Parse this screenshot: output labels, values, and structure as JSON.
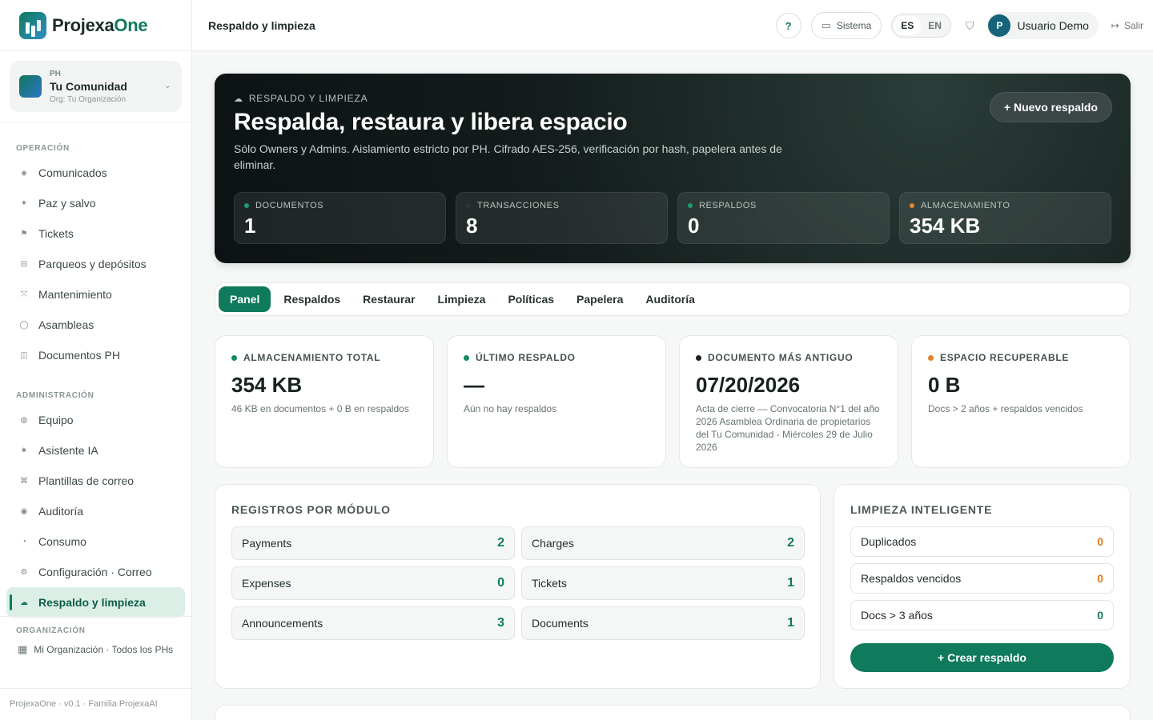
{
  "brand": {
    "name_a": "Projexa",
    "name_b": "One"
  },
  "community": {
    "tag": "PH",
    "name": "Tu Comunidad",
    "org": "Org: Tu Organización"
  },
  "sidebar": {
    "sections": [
      {
        "title": "OPERACIÓN",
        "items": [
          {
            "label": "Comunicados",
            "icon": "◈"
          },
          {
            "label": "Paz y salvo",
            "icon": "✦"
          },
          {
            "label": "Tickets",
            "icon": "⚑"
          },
          {
            "label": "Parqueos y depósitos",
            "icon": "⊟"
          },
          {
            "label": "Mantenimiento",
            "icon": "⤧"
          },
          {
            "label": "Asambleas",
            "icon": "◯"
          },
          {
            "label": "Documentos PH",
            "icon": "◫"
          }
        ]
      },
      {
        "title": "ADMINISTRACIÓN",
        "items": [
          {
            "label": "Equipo",
            "icon": "◍"
          },
          {
            "label": "Asistente IA",
            "icon": "✷"
          },
          {
            "label": "Plantillas de correo",
            "icon": "⌘"
          },
          {
            "label": "Auditoría",
            "icon": "◉"
          },
          {
            "label": "Consumo",
            "icon": "◔"
          },
          {
            "label": "Configuración · Correo",
            "icon": "⚙"
          },
          {
            "label": "Respaldo y limpieza",
            "icon": "☁",
            "active": true
          }
        ]
      }
    ],
    "org_section": "ORGANIZACIÓN",
    "org_item": "Mi Organización · Todos los PHs",
    "footer": "ProjexaOne · v0.1 · Familia ProjexaAI"
  },
  "topbar": {
    "title": "Respaldo y limpieza",
    "help": "?",
    "system": "Sistema",
    "lang_es": "ES",
    "lang_en": "EN",
    "avatar": "P",
    "user": "Usuario Demo",
    "logout": "Salir"
  },
  "hero": {
    "kicker": "RESPALDO Y LIMPIEZA",
    "title": "Respalda, restaura y libera espacio",
    "desc": "Sólo Owners y Admins. Aislamiento estricto por PH. Cifrado AES-256, verificación por hash, papelera antes de eliminar.",
    "button": "+ Nuevo respaldo",
    "stats": [
      {
        "label": "DOCUMENTOS",
        "value": "1",
        "color": "#1f9c6e"
      },
      {
        "label": "TRANSACCIONES",
        "value": "8",
        "color": "#2c3533"
      },
      {
        "label": "RESPALDOS",
        "value": "0",
        "color": "#1f9c6e"
      },
      {
        "label": "ALMACENAMIENTO",
        "value": "354 KB",
        "color": "#e6882a"
      }
    ]
  },
  "tabs": [
    "Panel",
    "Respaldos",
    "Restaurar",
    "Limpieza",
    "Políticas",
    "Papelera",
    "Auditoría"
  ],
  "metrics": [
    {
      "label": "ALMACENAMIENTO TOTAL",
      "value": "354 KB",
      "sub": "46 KB en documentos + 0 B en respaldos",
      "color": "#148a63"
    },
    {
      "label": "ÚLTIMO RESPALDO",
      "value": "—",
      "sub": "Aún no hay respaldos",
      "color": "#148a63"
    },
    {
      "label": "DOCUMENTO MÁS ANTIGUO",
      "value": "07/20/2026",
      "sub": "Acta de cierre — Convocatoria N°1 del año 2026 Asamblea Ordinaria de propietarios del Tu Comunidad - Miércoles 29 de Julio 2026",
      "color": "#16201d"
    },
    {
      "label": "ESPACIO RECUPERABLE",
      "value": "0 B",
      "sub": "Docs > 2 años + respaldos vencidos",
      "color": "#e0822a"
    }
  ],
  "modules": {
    "title": "REGISTROS POR MÓDULO",
    "items": [
      {
        "name": "Payments",
        "count": "2"
      },
      {
        "name": "Charges",
        "count": "2"
      },
      {
        "name": "Expenses",
        "count": "0"
      },
      {
        "name": "Tickets",
        "count": "1"
      },
      {
        "name": "Announcements",
        "count": "3"
      },
      {
        "name": "Documents",
        "count": "1"
      }
    ]
  },
  "cleanup": {
    "title": "LIMPIEZA INTELIGENTE",
    "items": [
      {
        "name": "Duplicados",
        "count": "0",
        "color": "#d97d1f"
      },
      {
        "name": "Respaldos vencidos",
        "count": "0",
        "color": "#d97d1f"
      },
      {
        "name": "Docs > 3 años",
        "count": "0",
        "color": "#0f7a5c"
      }
    ],
    "button": "+ Crear respaldo"
  }
}
